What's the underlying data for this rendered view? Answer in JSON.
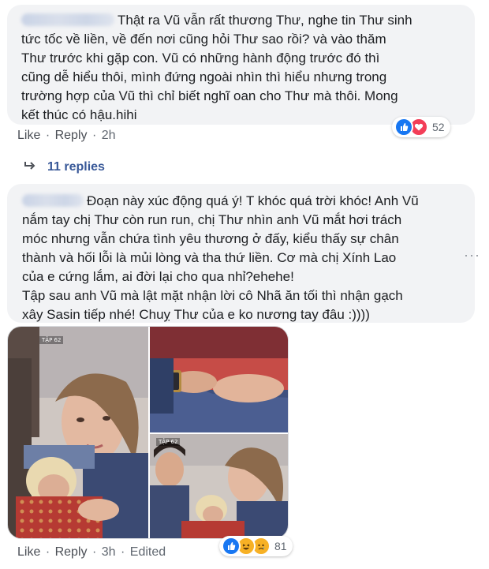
{
  "comment1": {
    "lines": [
      "Thật ra Vũ vẫn rất thương Thư, nghe tin Thư sinh",
      "tức tốc về liền, về đến nơi cũng hỏi Thư sao rồi? và vào thăm",
      "Thư trước khi gặp con. Vũ có những hành động trước đó thì",
      "cũng dễ hiểu thôi, mình đứng ngoài nhìn thì hiểu nhưng trong",
      "trường hợp của Vũ thì chỉ biết nghĩ oan cho Thư mà thôi. Mong",
      "kết thúc có hậu.hihi"
    ],
    "like_label": "Like",
    "reply_label": "Reply",
    "time": "2h",
    "reaction_count": "52",
    "reaction_icons": [
      "like-icon",
      "love-icon"
    ]
  },
  "replies_link": {
    "label": "11 replies"
  },
  "comment2": {
    "lines": [
      "Đoạn này xúc động quá ý! T khóc quá trời khóc! Anh Vũ",
      "nắm tay chị Thư còn run run, chị Thư nhìn anh Vũ mắt hơi trách",
      "móc nhưng vẫn chứa tình yêu thương ở đấy, kiểu thấy sự chân",
      "thành và hối lỗi là mủi lòng và tha thứ liền. Cơ mà chị Xính Lao",
      "của e cứng lắm, ai đời lại cho qua nhỉ?ehehe!",
      "Tập sau anh Vũ mà lật mặt nhận lời cô Nhã ăn tối thì nhận gạch",
      "xây Sasin tiếp nhé! Chuỵ Thư của e ko nương tay đâu :))))"
    ],
    "photo_tag": "TẬP 62",
    "like_label": "Like",
    "reply_label": "Reply",
    "time": "3h",
    "edited_label": "Edited",
    "reaction_count": "81",
    "reaction_icons": [
      "like-icon",
      "haha-icon",
      "sad-icon"
    ],
    "more_icon": "more-options-icon"
  },
  "colors": {
    "bubble": "#f2f3f5",
    "link": "#385898",
    "like_blue": "#1877f2",
    "love_red": "#f33e58",
    "haha_yellow": "#f7b125"
  }
}
